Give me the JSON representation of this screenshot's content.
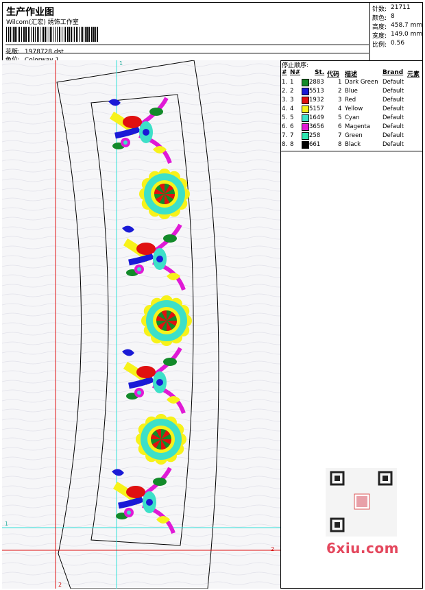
{
  "header": {
    "title": "生产作业图",
    "subtitle": "Wilcom(汇宏) 绣饰工作室",
    "file_label": "花版:",
    "file_value": "1978728.dst",
    "colorway_label": "色位:",
    "colorway_value": "Colorway 1"
  },
  "stats": [
    {
      "label": "针数:",
      "value": "21711"
    },
    {
      "label": "颜色:",
      "value": "8"
    },
    {
      "label": "高度:",
      "value": "458.7 mm"
    },
    {
      "label": "宽度:",
      "value": "149.0 mm"
    },
    {
      "label": "比例:",
      "value": "0.56"
    }
  ],
  "stop_sequence": {
    "title": "停止顺序:",
    "headers": {
      "num": "#",
      "no": "N#",
      "st": "St.",
      "code": "代码",
      "desc": "描述",
      "brand": "Brand",
      "element": "元素"
    },
    "rows": [
      {
        "num": "1.",
        "no": "1",
        "st": "2883",
        "code": "1",
        "desc": "Dark Green",
        "brand": "Default",
        "color": "#138a2a"
      },
      {
        "num": "2.",
        "no": "2",
        "st": "5513",
        "code": "2",
        "desc": "Blue",
        "brand": "Default",
        "color": "#1a1ad6"
      },
      {
        "num": "3.",
        "no": "3",
        "st": "1932",
        "code": "3",
        "desc": "Red",
        "brand": "Default",
        "color": "#e01010"
      },
      {
        "num": "4.",
        "no": "4",
        "st": "5157",
        "code": "4",
        "desc": "Yellow",
        "brand": "Default",
        "color": "#f7f21a"
      },
      {
        "num": "5.",
        "no": "5",
        "st": "1649",
        "code": "5",
        "desc": "Cyan",
        "brand": "Default",
        "color": "#3de0c8"
      },
      {
        "num": "6.",
        "no": "6",
        "st": "3656",
        "code": "6",
        "desc": "Magenta",
        "brand": "Default",
        "color": "#e01ad6"
      },
      {
        "num": "7.",
        "no": "7",
        "st": "258",
        "code": "7",
        "desc": "Green",
        "brand": "Default",
        "color": "#2ee6b0"
      },
      {
        "num": "8.",
        "no": "8",
        "st": "661",
        "code": "8",
        "desc": "Black",
        "brand": "Default",
        "color": "#000000"
      }
    ]
  },
  "canvas": {
    "guide_v_cyan": "1",
    "guide_h_cyan": "1",
    "guide_v_red": "2",
    "guide_h_red": "2"
  },
  "watermark": {
    "text": "6xiu.com",
    "qr_icon": "qr-code-icon"
  }
}
